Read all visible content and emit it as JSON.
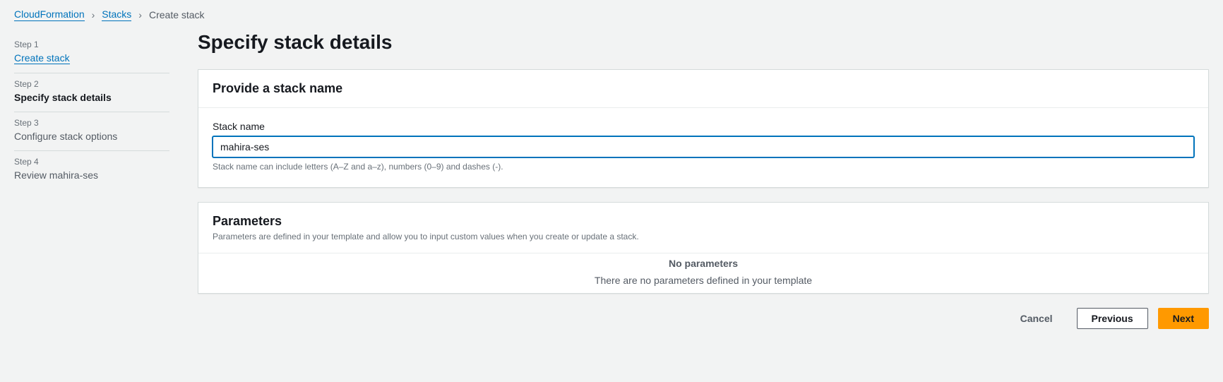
{
  "breadcrumb": {
    "items": [
      "CloudFormation",
      "Stacks"
    ],
    "current": "Create stack"
  },
  "sidebar": {
    "steps": [
      {
        "label": "Step 1",
        "title": "Create stack",
        "state": "link"
      },
      {
        "label": "Step 2",
        "title": "Specify stack details",
        "state": "active"
      },
      {
        "label": "Step 3",
        "title": "Configure stack options",
        "state": "future"
      },
      {
        "label": "Step 4",
        "title": "Review mahira-ses",
        "state": "future"
      }
    ]
  },
  "main": {
    "title": "Specify stack details",
    "stack_name_panel": {
      "heading": "Provide a stack name",
      "field_label": "Stack name",
      "value": "mahira-ses",
      "hint": "Stack name can include letters (A–Z and a–z), numbers (0–9) and dashes (-)."
    },
    "parameters_panel": {
      "heading": "Parameters",
      "desc": "Parameters are defined in your template and allow you to input custom values when you create or update a stack.",
      "empty_title": "No parameters",
      "empty_desc": "There are no parameters defined in your template"
    },
    "actions": {
      "cancel": "Cancel",
      "previous": "Previous",
      "next": "Next"
    }
  }
}
